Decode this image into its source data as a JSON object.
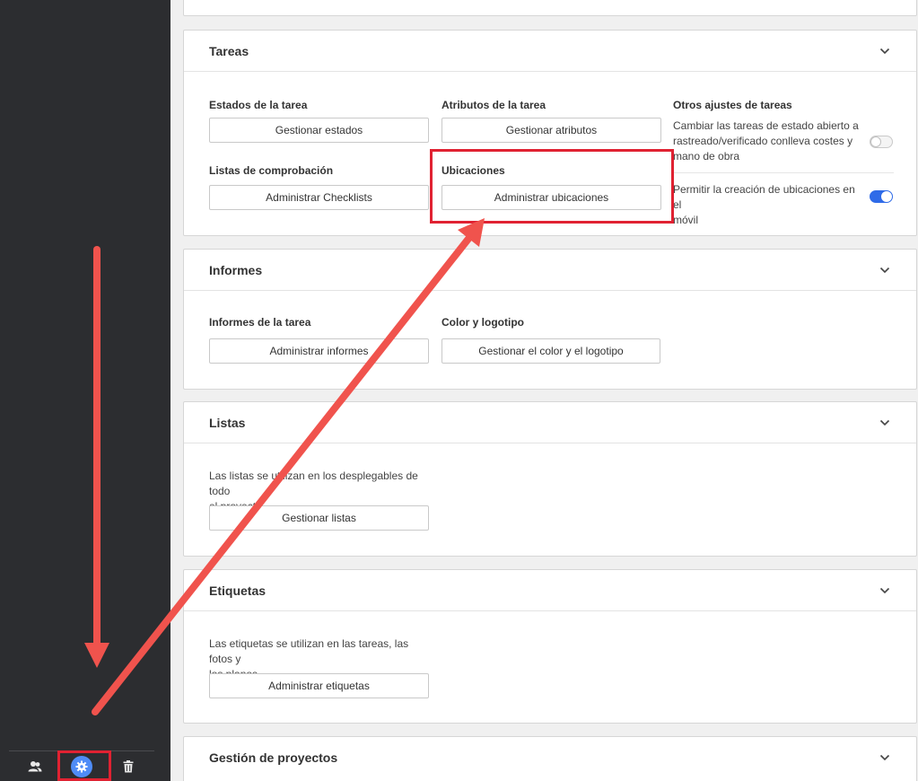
{
  "sections": {
    "tareas": {
      "title": "Tareas",
      "estados_label": "Estados de la tarea",
      "estados_button": "Gestionar estados",
      "atributos_label": "Atributos de la tarea",
      "atributos_button": "Gestionar atributos",
      "otros_label": "Otros ajustes de tareas",
      "toggle1_text_l1": "Cambiar las tareas de estado abierto a",
      "toggle1_text_l2": "rastreado/verificado conlleva costes y",
      "toggle1_text_l3": "mano de obra",
      "toggle1_on": false,
      "toggle2_text_l1": "Permitir la creación de ubicaciones en el",
      "toggle2_text_l2": "móvil",
      "toggle2_on": true,
      "checklists_label": "Listas de comprobación",
      "checklists_button": "Administrar Checklists",
      "ubicaciones_label": "Ubicaciones",
      "ubicaciones_button": "Administrar ubicaciones"
    },
    "informes": {
      "title": "Informes",
      "tarea_label": "Informes de la tarea",
      "tarea_button": "Administrar informes",
      "color_label": "Color y logotipo",
      "color_button": "Gestionar el color y el logotipo"
    },
    "listas": {
      "title": "Listas",
      "desc_l1": "Las listas se utilizan en los desplegables de todo",
      "desc_l2": "el proyecto",
      "button": "Gestionar listas"
    },
    "etiquetas": {
      "title": "Etiquetas",
      "desc_l1": "Las etiquetas se utilizan en las tareas, las fotos y",
      "desc_l2": "los planos",
      "button": "Administrar etiquetas"
    },
    "gestion": {
      "title": "Gestión de proyectos"
    }
  },
  "sidebar": {
    "icons": [
      "users-icon",
      "gear-icon",
      "trash-icon"
    ]
  },
  "colors": {
    "sidebar_bg": "#2c2d30",
    "accent": "#4f8cf7",
    "annotation": "#e02232",
    "arrow": "#f0534d",
    "toggle_on": "#2f6be8"
  }
}
